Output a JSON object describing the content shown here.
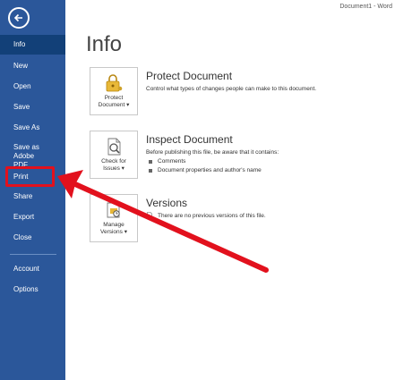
{
  "window": {
    "title": "Document1 - Word"
  },
  "page": {
    "title": "Info"
  },
  "sidebar": {
    "items": [
      {
        "label": "Info"
      },
      {
        "label": "New"
      },
      {
        "label": "Open"
      },
      {
        "label": "Save"
      },
      {
        "label": "Save As"
      },
      {
        "label": "Save as Adobe PDF"
      },
      {
        "label": "Print"
      },
      {
        "label": "Share"
      },
      {
        "label": "Export"
      },
      {
        "label": "Close"
      },
      {
        "label": "Account"
      },
      {
        "label": "Options"
      }
    ]
  },
  "protect": {
    "button_line1": "Protect",
    "button_line2": "Document",
    "title": "Protect Document",
    "description": "Control what types of changes people can make to this document."
  },
  "inspect": {
    "button_line1": "Check for",
    "button_line2": "Issues",
    "title": "Inspect Document",
    "description": "Before publishing this file, be aware that it contains:",
    "bullets": [
      "Comments",
      "Document properties and author's name"
    ]
  },
  "versions": {
    "button_line1": "Manage",
    "button_line2": "Versions",
    "title": "Versions",
    "description": "There are no previous versions of this file."
  },
  "colors": {
    "sidebar": "#2b579a",
    "sidebar_active": "#124078",
    "highlight": "#e2111d"
  }
}
